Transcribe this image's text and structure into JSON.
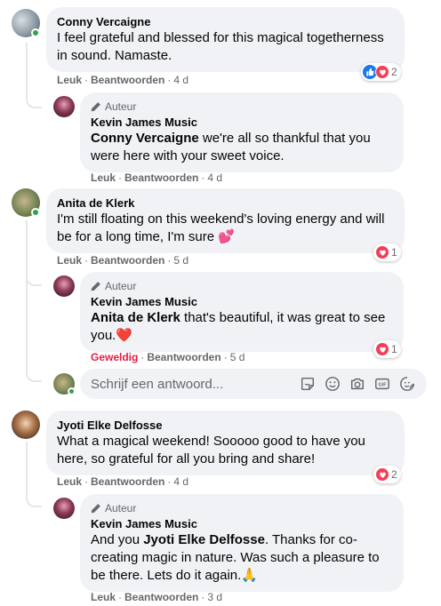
{
  "comments": [
    {
      "author": "Conny Vercaigne",
      "text": "I feel grateful and blessed for this magical togetherness in sound. Namaste.",
      "like": "Leuk",
      "reply": "Beantwoorden",
      "time": "4 d",
      "reaction_count": "2",
      "reaction_icons": [
        "like-icon",
        "love-icon"
      ]
    },
    {
      "author": "Anita de Klerk",
      "text": "I'm still floating on this weekend's loving energy and will be for a long time, I'm sure 💕",
      "like": "Leuk",
      "reply": "Beantwoorden",
      "time": "5 d",
      "reaction_count": "1",
      "reaction_icons": [
        "love-icon"
      ]
    },
    {
      "author": "Jyoti Elke Delfosse",
      "text": "What a magical weekend! Sooooo good to have you here, so grateful for all you bring and share!",
      "like": "Leuk",
      "reply": "Beantwoorden",
      "time": "4 d",
      "reaction_count": "2",
      "reaction_icons": [
        "love-icon"
      ]
    }
  ],
  "replies": [
    {
      "badge": "Auteur",
      "author": "Kevin James Music",
      "mention": "Conny Vercaigne",
      "text": " we're all so thankful that you were here with your sweet voice.",
      "like": "Leuk",
      "reply": "Beantwoorden",
      "time": "4 d"
    },
    {
      "badge": "Auteur",
      "author": "Kevin James Music",
      "mention": "Anita de Klerk",
      "text": " that's beautiful, it was great to see you.❤️",
      "like": "Geweldig",
      "reply": "Beantwoorden",
      "time": "5 d",
      "reaction_count": "1",
      "reaction_icons": [
        "love-icon"
      ]
    },
    {
      "badge": "Auteur",
      "author": "Kevin James Music",
      "pre": "And you ",
      "mention": "Jyoti Elke Delfosse",
      "text": ". Thanks for co-creating magic in nature. Was such a pleasure to be there. Lets do it again.🙏",
      "like": "Leuk",
      "reply": "Beantwoorden",
      "time": "3 d"
    }
  ],
  "reply_input": {
    "placeholder": "Schrijf een antwoord...",
    "icons": [
      "sticker-icon",
      "emoji-icon",
      "camera-icon",
      "gif-icon",
      "avatar-sticker-icon"
    ]
  },
  "separator": "·",
  "colors": {
    "online": "#31a24c",
    "like": "#1877f2",
    "love": "#f33e58",
    "liked_text": "#e41e3f",
    "bubble": "#f0f2f5"
  }
}
